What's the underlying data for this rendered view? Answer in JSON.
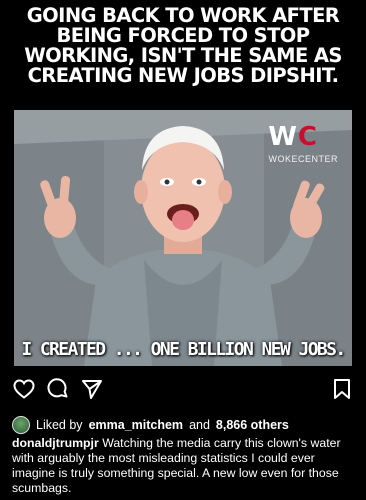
{
  "meme": {
    "headline_lines": [
      "GOING BACK TO WORK AFTER",
      "BEING FORCED TO STOP",
      "WORKING, ISN'T THE SAME AS",
      "CREATING NEW JOBS DIPSHIT."
    ],
    "watermark_logo": "WC",
    "watermark_text": "WOKECENTER",
    "caption": "I CREATED ... ONE BILLION NEW JOBS."
  },
  "actions": {
    "like_icon": "heart-icon",
    "comment_icon": "comment-icon",
    "share_icon": "send-icon",
    "save_icon": "bookmark-icon"
  },
  "likes": {
    "prefix": "Liked by",
    "user": "emma_mitchem",
    "middle": "and",
    "count_text": "8,866 others"
  },
  "post": {
    "username": "donaldjtrumpjr",
    "text": "Watching the media carry this clown's water with arguably the most misleading statistics I could ever imagine is truly something special. A new low even for those scumbags."
  },
  "colors": {
    "background": "#000000",
    "text": "#ffffff",
    "logo_accent": "#c8102e"
  }
}
